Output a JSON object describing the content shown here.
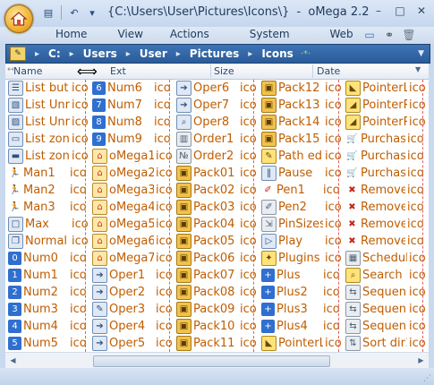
{
  "window": {
    "title_path": "{C:\\Users\\User\\Pictures\\Icons\\}",
    "title_sep": "-",
    "app_name": "oMega 2.2"
  },
  "quick_access": [
    {
      "icon": "layout-icon",
      "glyph": "▤"
    },
    {
      "icon": "undo-icon",
      "glyph": "↶"
    },
    {
      "icon": "dropdown-icon",
      "glyph": "▾"
    }
  ],
  "window_buttons": [
    {
      "icon": "minimize-icon",
      "glyph": "–"
    },
    {
      "icon": "maximize-icon",
      "glyph": "□"
    },
    {
      "icon": "close-icon",
      "glyph": "✕"
    }
  ],
  "menu": [
    "Home",
    "View",
    "Actions",
    "System",
    "Web"
  ],
  "breadcrumb": [
    "C:",
    "Users",
    "User",
    "Pictures",
    "Icons"
  ],
  "columns": {
    "name": "Name",
    "ext": "Ext",
    "size": "Size",
    "date": "Date"
  },
  "files": [
    [
      {
        "name": "List but",
        "ext": "ico",
        "icon": "list-icon",
        "glyph": "☰",
        "style": "ic-win"
      },
      {
        "name": "List Unrc",
        "ext": "ico",
        "icon": "list-unranked-icon",
        "glyph": "▧",
        "style": "ic-win"
      },
      {
        "name": "List Unrc",
        "ext": "ico",
        "icon": "list-unranked-icon",
        "glyph": "▨",
        "style": "ic-win"
      },
      {
        "name": "List zone",
        "ext": "ico",
        "icon": "list-zone-icon",
        "glyph": "▭",
        "style": "ic-win"
      },
      {
        "name": "List zone",
        "ext": "ico",
        "icon": "list-zone-icon",
        "glyph": "▬",
        "style": "ic-win"
      },
      {
        "name": "Man1",
        "ext": "ico",
        "icon": "running-man-icon",
        "glyph": "🏃",
        "style": "ic-run"
      },
      {
        "name": "Man2",
        "ext": "ico",
        "icon": "running-man-icon",
        "glyph": "🏃",
        "style": "ic-run"
      },
      {
        "name": "Man3",
        "ext": "ico",
        "icon": "running-man-icon",
        "glyph": "🏃",
        "style": "ic-run"
      },
      {
        "name": "Max",
        "ext": "ico",
        "icon": "maximize-window-icon",
        "glyph": "□",
        "style": "ic-win"
      },
      {
        "name": "Normal",
        "ext": "ico",
        "icon": "normal-window-icon",
        "glyph": "❐",
        "style": "ic-win"
      },
      {
        "name": "Num0",
        "ext": "ico",
        "icon": "number-0-icon",
        "glyph": "0",
        "style": "ic-blue"
      },
      {
        "name": "Num1",
        "ext": "ico",
        "icon": "number-1-icon",
        "glyph": "1",
        "style": "ic-blue"
      },
      {
        "name": "Num2",
        "ext": "ico",
        "icon": "number-2-icon",
        "glyph": "2",
        "style": "ic-blue"
      },
      {
        "name": "Num3",
        "ext": "ico",
        "icon": "number-3-icon",
        "glyph": "3",
        "style": "ic-blue"
      },
      {
        "name": "Num4",
        "ext": "ico",
        "icon": "number-4-icon",
        "glyph": "4",
        "style": "ic-blue"
      },
      {
        "name": "Num5",
        "ext": "ico",
        "icon": "number-5-icon",
        "glyph": "5",
        "style": "ic-blue"
      }
    ],
    [
      {
        "name": "Num6",
        "ext": "ico",
        "icon": "number-6-icon",
        "glyph": "6",
        "style": "ic-blue"
      },
      {
        "name": "Num7",
        "ext": "ico",
        "icon": "number-7-icon",
        "glyph": "7",
        "style": "ic-blue"
      },
      {
        "name": "Num8",
        "ext": "ico",
        "icon": "number-8-icon",
        "glyph": "8",
        "style": "ic-blue"
      },
      {
        "name": "Num9",
        "ext": "ico",
        "icon": "number-9-icon",
        "glyph": "9",
        "style": "ic-blue"
      },
      {
        "name": "oMega1",
        "ext": "ico",
        "icon": "home-icon",
        "glyph": "⌂",
        "style": "ic-home"
      },
      {
        "name": "oMega2",
        "ext": "ico",
        "icon": "home-icon",
        "glyph": "⌂",
        "style": "ic-home"
      },
      {
        "name": "oMega3",
        "ext": "ico",
        "icon": "home-icon",
        "glyph": "⌂",
        "style": "ic-home"
      },
      {
        "name": "oMega4",
        "ext": "ico",
        "icon": "home-icon",
        "glyph": "⌂",
        "style": "ic-home"
      },
      {
        "name": "oMega5",
        "ext": "ico",
        "icon": "home-icon",
        "glyph": "⌂",
        "style": "ic-home"
      },
      {
        "name": "oMega6",
        "ext": "ico",
        "icon": "home-icon",
        "glyph": "⌂",
        "style": "ic-home"
      },
      {
        "name": "oMega7",
        "ext": "ico",
        "icon": "home-icon",
        "glyph": "⌂",
        "style": "ic-home"
      },
      {
        "name": "Oper1",
        "ext": "ico",
        "icon": "operation-icon",
        "glyph": "➔",
        "style": "ic-win"
      },
      {
        "name": "Oper2",
        "ext": "ico",
        "icon": "operation-icon",
        "glyph": "➔",
        "style": "ic-win"
      },
      {
        "name": "Oper3",
        "ext": "ico",
        "icon": "operation-icon",
        "glyph": "✎",
        "style": "ic-win"
      },
      {
        "name": "Oper4",
        "ext": "ico",
        "icon": "operation-icon",
        "glyph": "➔",
        "style": "ic-win"
      },
      {
        "name": "Oper5",
        "ext": "ico",
        "icon": "operation-icon",
        "glyph": "➔",
        "style": "ic-win"
      }
    ],
    [
      {
        "name": "Oper6",
        "ext": "ico",
        "icon": "operation-icon",
        "glyph": "➔",
        "style": "ic-win"
      },
      {
        "name": "Oper7",
        "ext": "ico",
        "icon": "operation-icon",
        "glyph": "➔",
        "style": "ic-win"
      },
      {
        "name": "Oper8",
        "ext": "ico",
        "icon": "search-document-icon",
        "glyph": "⌕",
        "style": "ic-win"
      },
      {
        "name": "Order1",
        "ext": "ico",
        "icon": "bar-order-icon",
        "glyph": "▥",
        "style": "ic-gray"
      },
      {
        "name": "Order2",
        "ext": "ico",
        "icon": "numeric-order-icon",
        "glyph": "№",
        "style": "ic-gray"
      },
      {
        "name": "Pack01",
        "ext": "ico",
        "icon": "package-icon",
        "glyph": "▣",
        "style": "ic-pack"
      },
      {
        "name": "Pack02",
        "ext": "ico",
        "icon": "package-icon",
        "glyph": "▣",
        "style": "ic-pack"
      },
      {
        "name": "Pack03",
        "ext": "ico",
        "icon": "package-icon",
        "glyph": "▣",
        "style": "ic-pack"
      },
      {
        "name": "Pack04",
        "ext": "ico",
        "icon": "package-icon",
        "glyph": "▣",
        "style": "ic-pack"
      },
      {
        "name": "Pack05",
        "ext": "ico",
        "icon": "package-icon",
        "glyph": "▣",
        "style": "ic-pack"
      },
      {
        "name": "Pack06",
        "ext": "ico",
        "icon": "package-icon",
        "glyph": "▣",
        "style": "ic-pack"
      },
      {
        "name": "Pack07",
        "ext": "ico",
        "icon": "package-icon",
        "glyph": "▣",
        "style": "ic-pack"
      },
      {
        "name": "Pack08",
        "ext": "ico",
        "icon": "package-icon",
        "glyph": "▣",
        "style": "ic-pack"
      },
      {
        "name": "Pack09",
        "ext": "ico",
        "icon": "package-icon",
        "glyph": "▣",
        "style": "ic-pack"
      },
      {
        "name": "Pack10",
        "ext": "ico",
        "icon": "package-icon",
        "glyph": "▣",
        "style": "ic-pack"
      },
      {
        "name": "Pack11",
        "ext": "ico",
        "icon": "package-icon",
        "glyph": "▣",
        "style": "ic-pack"
      }
    ],
    [
      {
        "name": "Pack12",
        "ext": "ico",
        "icon": "package-icon",
        "glyph": "▣",
        "style": "ic-pack"
      },
      {
        "name": "Pack13",
        "ext": "ico",
        "icon": "package-icon",
        "glyph": "▣",
        "style": "ic-pack"
      },
      {
        "name": "Pack14",
        "ext": "ico",
        "icon": "package-icon",
        "glyph": "▣",
        "style": "ic-pack"
      },
      {
        "name": "Pack15",
        "ext": "ico",
        "icon": "package-icon",
        "glyph": "▣",
        "style": "ic-pack"
      },
      {
        "name": "Path edi",
        "ext": "ico",
        "icon": "path-edit-icon",
        "glyph": "✎",
        "style": "ic-yellow"
      },
      {
        "name": "Pause",
        "ext": "ico",
        "icon": "pause-icon",
        "glyph": "‖",
        "style": "ic-win"
      },
      {
        "name": "Pen1",
        "ext": "ico",
        "icon": "pen-icon",
        "glyph": "✐",
        "style": "ic-red"
      },
      {
        "name": "Pen2",
        "ext": "ico",
        "icon": "pen-icon",
        "glyph": "✐",
        "style": "ic-gray"
      },
      {
        "name": "PinSizes",
        "ext": "ico",
        "icon": "pin-sizes-icon",
        "glyph": "⇲",
        "style": "ic-gray"
      },
      {
        "name": "Play",
        "ext": "ico",
        "icon": "play-icon",
        "glyph": "▷",
        "style": "ic-win"
      },
      {
        "name": "Plugins",
        "ext": "ico",
        "icon": "plugins-icon",
        "glyph": "✦",
        "style": "ic-yellow"
      },
      {
        "name": "Plus",
        "ext": "ico",
        "icon": "plus-icon",
        "glyph": "+",
        "style": "ic-blue"
      },
      {
        "name": "Plus2",
        "ext": "ico",
        "icon": "plus-icon",
        "glyph": "+",
        "style": "ic-blue"
      },
      {
        "name": "Plus3",
        "ext": "ico",
        "icon": "plus-icon",
        "glyph": "+",
        "style": "ic-blue"
      },
      {
        "name": "Plus4",
        "ext": "ico",
        "icon": "plus-icon",
        "glyph": "+",
        "style": "ic-blue"
      },
      {
        "name": "PointerL",
        "ext": "ico",
        "icon": "pointer-icon",
        "glyph": "◣",
        "style": "ic-yellow"
      }
    ],
    [
      {
        "name": "PointerL",
        "ext": "ico",
        "icon": "pointer-icon",
        "glyph": "◣",
        "style": "ic-yellow"
      },
      {
        "name": "PointerR",
        "ext": "ico",
        "icon": "pointer-icon",
        "glyph": "◢",
        "style": "ic-yellow"
      },
      {
        "name": "PointerR",
        "ext": "ico",
        "icon": "pointer-icon",
        "glyph": "◢",
        "style": "ic-yellow"
      },
      {
        "name": "Purchase",
        "ext": "ico",
        "icon": "cart-icon",
        "glyph": "🛒",
        "style": "ic-cart"
      },
      {
        "name": "Purchase",
        "ext": "ico",
        "icon": "cart-icon",
        "glyph": "🛒",
        "style": "ic-cart"
      },
      {
        "name": "Purchase",
        "ext": "ico",
        "icon": "cart-icon",
        "glyph": "🛒",
        "style": "ic-cart"
      },
      {
        "name": "Remove",
        "ext": "ico",
        "icon": "remove-icon",
        "glyph": "✖",
        "style": "ic-red"
      },
      {
        "name": "Remove",
        "ext": "ico",
        "icon": "remove-icon",
        "glyph": "✖",
        "style": "ic-red"
      },
      {
        "name": "Remove",
        "ext": "ico",
        "icon": "remove-icon",
        "glyph": "✖",
        "style": "ic-red"
      },
      {
        "name": "Remove",
        "ext": "ico",
        "icon": "remove-icon",
        "glyph": "✖",
        "style": "ic-red"
      },
      {
        "name": "Schedul",
        "ext": "ico",
        "icon": "schedule-icon",
        "glyph": "▦",
        "style": "ic-gray"
      },
      {
        "name": "Search",
        "ext": "ico",
        "icon": "search-icon",
        "glyph": "⌕",
        "style": "ic-yellow"
      },
      {
        "name": "Sequen",
        "ext": "ico",
        "icon": "sequence-icon",
        "glyph": "⇆",
        "style": "ic-gray"
      },
      {
        "name": "Sequen",
        "ext": "ico",
        "icon": "sequence-icon",
        "glyph": "⇆",
        "style": "ic-gray"
      },
      {
        "name": "Sequen",
        "ext": "ico",
        "icon": "sequence-icon",
        "glyph": "⇆",
        "style": "ic-gray"
      },
      {
        "name": "Sort dir1",
        "ext": "ico",
        "icon": "sort-icon",
        "glyph": "⇅",
        "style": "ic-gray"
      }
    ]
  ]
}
